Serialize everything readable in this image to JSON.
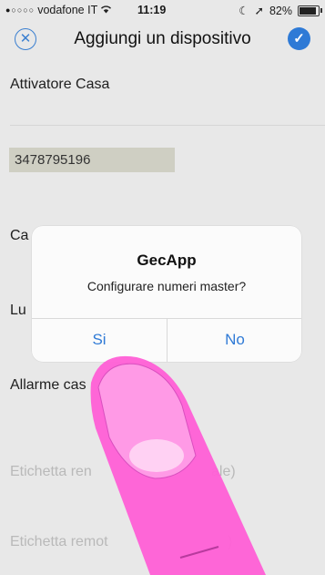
{
  "status_bar": {
    "signal": "●○○○○",
    "carrier": "vodafone IT",
    "wifi_icon": "wifi-icon",
    "time": "11:19",
    "battery": "82%"
  },
  "navbar": {
    "title": "Aggiungi un dispositivo",
    "close_icon": "close-icon",
    "confirm_icon": "checkmark-icon"
  },
  "form": {
    "device_name": "Attivatore Casa",
    "phone_number": "3478795196",
    "label_ca_partial": "Ca",
    "label_lu_partial": "Lu",
    "label_allarme_partial": "Allarme cas",
    "placeholder_1_left": "Etichetta ren",
    "placeholder_1_right": "ale)",
    "placeholder_2_left": "Etichetta remot",
    "placeholder_2_right": ")"
  },
  "alert": {
    "title": "GecApp",
    "message": "Configurare numeri master?",
    "yes_label": "Si",
    "no_label": "No"
  },
  "colors": {
    "accent": "#2f7ad6",
    "finger": "#ff5fd6"
  }
}
